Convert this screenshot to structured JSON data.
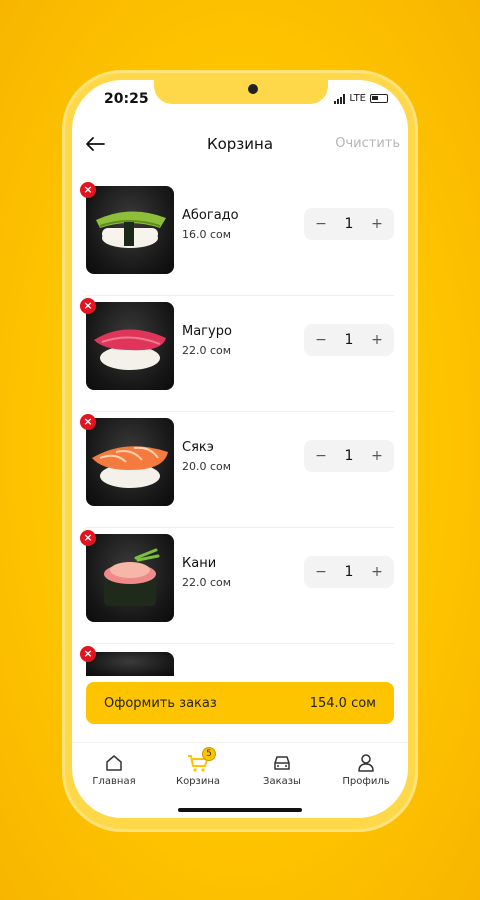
{
  "status_bar": {
    "time": "20:25",
    "network": "LTE"
  },
  "header": {
    "title": "Корзина",
    "clear_label": "Очистить"
  },
  "cart": {
    "items": [
      {
        "name": "Абогадо",
        "price": "16.0 сом",
        "qty": "1",
        "minus": "−",
        "plus": "+",
        "remove": "×"
      },
      {
        "name": "Магуро",
        "price": "22.0 сом",
        "qty": "1",
        "minus": "−",
        "plus": "+",
        "remove": "×"
      },
      {
        "name": "Сякэ",
        "price": "20.0 сом",
        "qty": "1",
        "minus": "−",
        "plus": "+",
        "remove": "×"
      },
      {
        "name": "Кани",
        "price": "22.0 сом",
        "qty": "1",
        "minus": "−",
        "plus": "+",
        "remove": "×"
      }
    ],
    "partial_remove": "×"
  },
  "order": {
    "label": "Оформить заказ",
    "total": "154.0 сом"
  },
  "tabbar": {
    "items": [
      {
        "label": "Главная",
        "icon": "home-icon"
      },
      {
        "label": "Корзина",
        "icon": "cart-icon",
        "badge": "5"
      },
      {
        "label": "Заказы",
        "icon": "orders-icon"
      },
      {
        "label": "Профиль",
        "icon": "profile-icon"
      }
    ]
  },
  "colors": {
    "accent": "#ffc400",
    "remove": "#e2141f",
    "clear": "#b5b5b5"
  }
}
